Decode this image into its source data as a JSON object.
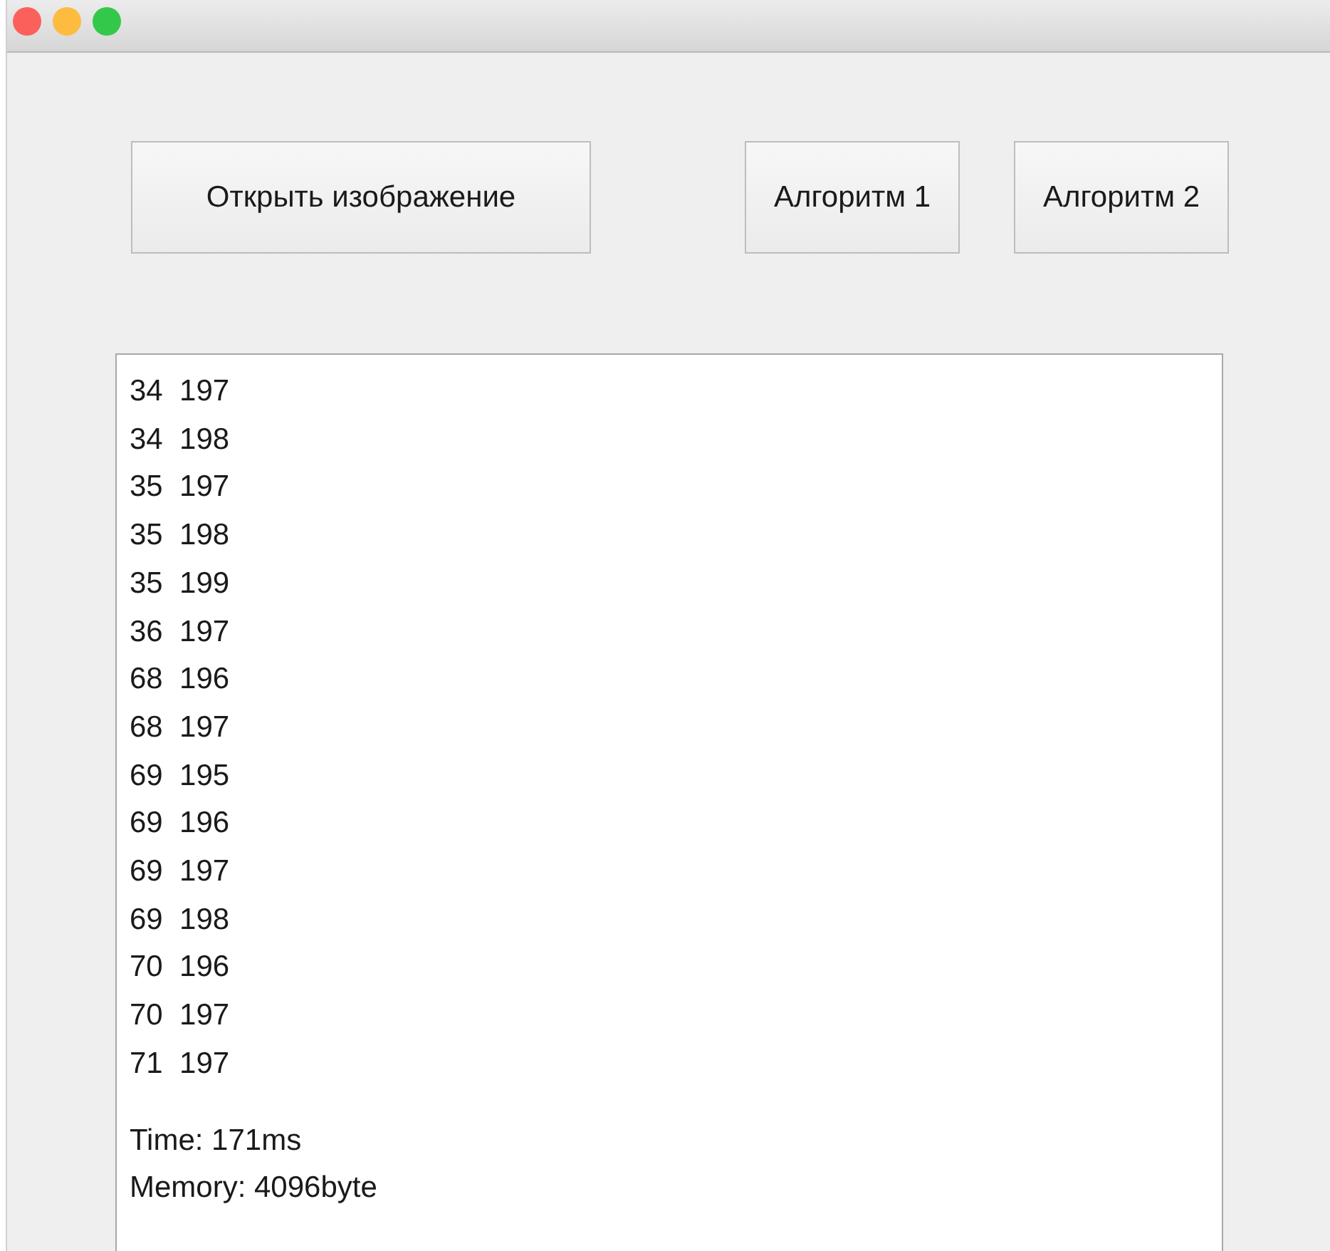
{
  "buttons": [
    {
      "label": "Открыть изображение"
    },
    {
      "label": "Алгоритм 1"
    },
    {
      "label": "Алгоритм 2"
    }
  ],
  "output": {
    "lines": [
      "34  197",
      "34  198",
      "35  197",
      "35  198",
      "35  199",
      "36  197",
      "68  196",
      "68  197",
      "69  195",
      "69  196",
      "69  197",
      "69  198",
      "70  196",
      "70  197",
      "71  197"
    ],
    "stats": [
      "Time: 171ms",
      "Memory: 4096byte"
    ]
  }
}
